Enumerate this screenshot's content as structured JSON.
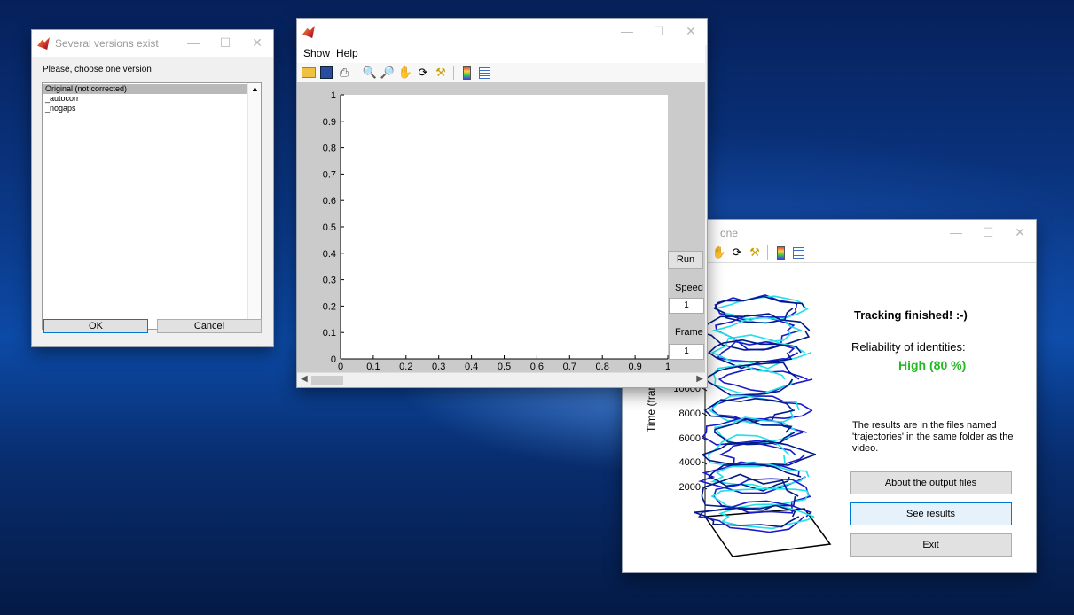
{
  "dialog": {
    "title": "Several versions exist",
    "prompt": "Please, choose one version",
    "options": [
      "Original (not corrected)",
      "_autocorr",
      "_nogaps"
    ],
    "ok_label": "OK",
    "cancel_label": "Cancel"
  },
  "plotwin": {
    "menu": [
      "Show",
      "Help"
    ],
    "toolbar_icons": [
      "open-icon",
      "save-icon",
      "print-icon",
      "zoom-in-icon",
      "zoom-out-icon",
      "pan-icon",
      "rotate-icon",
      "data-cursor-icon",
      "colorbar-icon",
      "legend-icon"
    ],
    "run_label": "Run",
    "speed_label": "Speed",
    "speed_value": "1",
    "frame_label": "Frame",
    "frame_value": "1"
  },
  "chart_data": {
    "type": "line",
    "title": "",
    "xlabel": "",
    "ylabel": "",
    "xlim": [
      0,
      1
    ],
    "ylim": [
      0,
      1
    ],
    "xticks": [
      "0",
      "0.1",
      "0.2",
      "0.3",
      "0.4",
      "0.5",
      "0.6",
      "0.7",
      "0.8",
      "0.9",
      "1"
    ],
    "yticks": [
      "0",
      "0.1",
      "0.2",
      "0.3",
      "0.4",
      "0.5",
      "0.6",
      "0.7",
      "0.8",
      "0.9",
      "1"
    ],
    "series": []
  },
  "results": {
    "title": "one",
    "finished": "Tracking finished! :-)",
    "reliability_label": "Reliability of identities:",
    "reliability_value": "High (80 %)",
    "reliability_color": "#22bb22",
    "message": "The results are in the files named 'trajectories' in the same folder as the video.",
    "about_label": "About the output files",
    "see_label": "See results",
    "exit_label": "Exit",
    "axis_label": "Time (fram",
    "z_ticks": [
      "10000",
      "8000",
      "6000",
      "4000",
      "2000"
    ]
  },
  "colors": {
    "accent": "#0078d7",
    "blue_track": "#1a1acc",
    "cyan_track": "#22e0e8"
  }
}
